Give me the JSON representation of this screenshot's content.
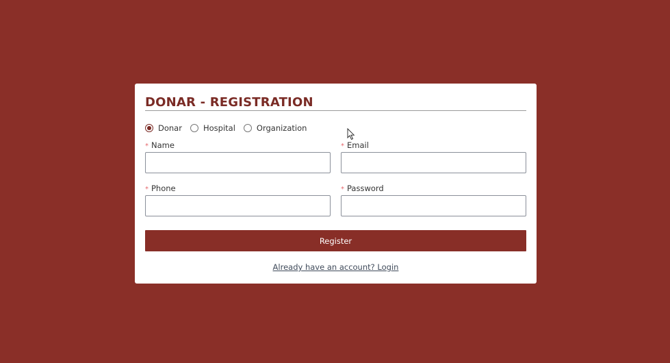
{
  "form": {
    "title": "DONAR - REGISTRATION",
    "roles": [
      {
        "label": "Donar",
        "checked": true
      },
      {
        "label": "Hospital",
        "checked": false
      },
      {
        "label": "Organization",
        "checked": false
      }
    ],
    "fields": {
      "name": {
        "label": "Name",
        "value": "",
        "required": true
      },
      "email": {
        "label": "Email",
        "value": "",
        "required": true
      },
      "phone": {
        "label": "Phone",
        "value": "",
        "required": true
      },
      "password": {
        "label": "Password",
        "value": "",
        "required": true
      }
    },
    "required_marker": "*",
    "register_label": "Register",
    "login_link": "Already have an account? Login"
  },
  "colors": {
    "background": "#8a2f28",
    "accent": "#7a2b25",
    "button": "#882e27",
    "required_marker": "#e6686d"
  }
}
